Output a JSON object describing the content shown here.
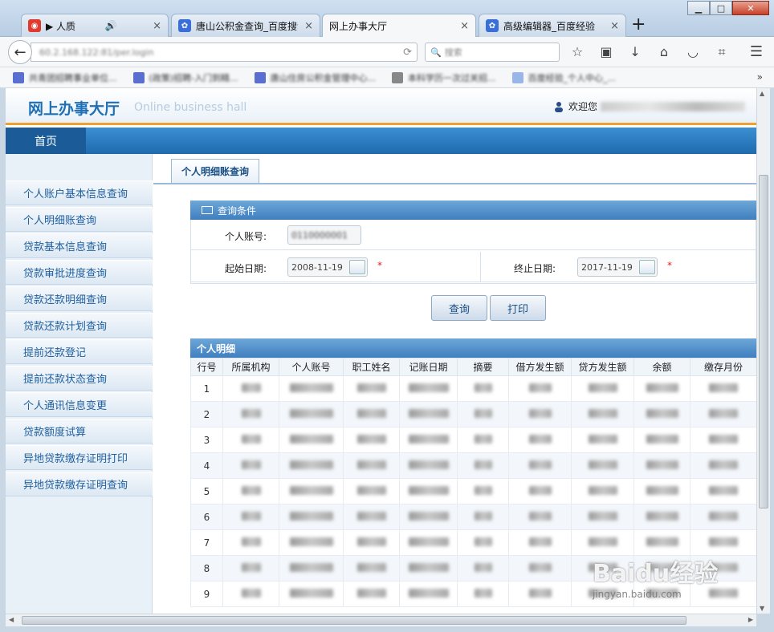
{
  "browser": {
    "tabs": [
      {
        "label": "▶ 人质",
        "extra": "🔊",
        "active": false
      },
      {
        "label": "唐山公积金查询_百度搜索",
        "active": false
      },
      {
        "label": "网上办事大厅",
        "active": true
      },
      {
        "label": "高级编辑器_百度经验",
        "active": false
      }
    ],
    "new_tab": "+",
    "url": "60.2.168.122:81/per.login",
    "search_placeholder": "搜索",
    "bookmarks": [
      "共青团招聘事业单位...",
      "(政策)招聘-入门到精...",
      "唐山住房公积金管理中心...",
      "本科学历一次过关招...",
      "百度经验_个人中心_..."
    ]
  },
  "header": {
    "title_cn": "网上办事大厅",
    "title_en": "Online business hall",
    "welcome": "欢迎您"
  },
  "topnav": {
    "home": "首页"
  },
  "sidebar": {
    "items": [
      "个人账户基本信息查询",
      "个人明细账查询",
      "贷款基本信息查询",
      "贷款审批进度查询",
      "贷款还款明细查询",
      "贷款还款计划查询",
      "提前还款登记",
      "提前还款状态查询",
      "个人通讯信息变更",
      "贷款额度试算",
      "异地贷款缴存证明打印",
      "异地贷款缴存证明查询"
    ]
  },
  "content": {
    "tab": "个人明细账查询",
    "query_title": "查询条件",
    "account_label": "个人账号:",
    "account_value": "0110000001",
    "start_label": "起始日期:",
    "start_value": "2008-11-19",
    "end_label": "终止日期:",
    "end_value": "2017-11-19",
    "required_mark": "*",
    "query_button": "查询",
    "print_button": "打印",
    "detail_title": "个人明细",
    "columns": [
      "行号",
      "所属机构",
      "个人账号",
      "职工姓名",
      "记账日期",
      "摘要",
      "借方发生额",
      "贷方发生额",
      "余额",
      "缴存月份"
    ],
    "rows": [
      "1",
      "2",
      "3",
      "4",
      "5",
      "6",
      "7",
      "8",
      "9"
    ]
  },
  "watermark": {
    "text": "Baidu经验",
    "sub": "jingyan.baidu.com"
  }
}
